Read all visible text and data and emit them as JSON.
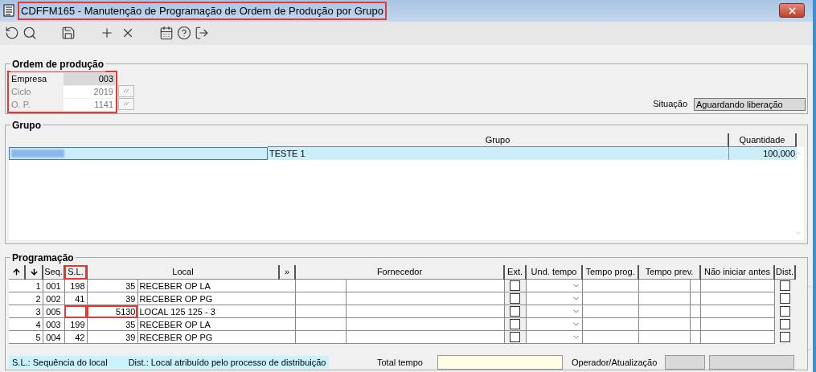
{
  "window": {
    "title": "CDFFM165 - Manutenção de Programação de Ordem de Produção por Grupo",
    "title_highlighted": true
  },
  "ordem": {
    "legend": "Ordem de produção",
    "highlighted": true,
    "fields": [
      {
        "label": "Empresa",
        "value": "003",
        "disabled": false,
        "lookup": false
      },
      {
        "label": "Ciclo",
        "value": "2019",
        "disabled": true,
        "lookup": true
      },
      {
        "label": "O. P.",
        "value": "1141",
        "disabled": true,
        "lookup": true
      }
    ],
    "situacao": {
      "label": "Situação",
      "value": "Aguardando liberação"
    }
  },
  "grupo": {
    "legend": "Grupo",
    "columns": [
      "Grupo",
      "Quantidade"
    ],
    "rows": [
      {
        "selected": true,
        "grupo": "TESTE 1",
        "quantidade": "100,000"
      }
    ]
  },
  "programacao": {
    "legend": "Programação",
    "columns": [
      {
        "label": "Seq.",
        "highlighted": false
      },
      {
        "label": "S.L.",
        "highlighted": true
      },
      {
        "label": "Local",
        "highlighted": false
      },
      {
        "label": "»",
        "highlighted": false
      },
      {
        "label": "Fornecedor",
        "highlighted": false
      },
      {
        "label": "Ext.",
        "highlighted": false
      },
      {
        "label": "Und. tempo",
        "highlighted": false
      },
      {
        "label": "Tempo prog.",
        "highlighted": false
      },
      {
        "label": "Tempo prev.",
        "highlighted": false
      },
      {
        "label": "Não iniciar antes",
        "highlighted": false
      },
      {
        "label": "Dist.",
        "highlighted": false
      }
    ],
    "rows": [
      {
        "num": "1",
        "seq": "001",
        "sl": "198",
        "local_code": "35",
        "local": "RECEBER OP LA",
        "ext": false,
        "dist": false,
        "highlighted": false
      },
      {
        "num": "2",
        "seq": "002",
        "sl": "41",
        "local_code": "39",
        "local": "RECEBER OP PG",
        "ext": false,
        "dist": false,
        "highlighted": false
      },
      {
        "num": "3",
        "seq": "005",
        "sl": "",
        "local_code": "5130",
        "local": "LOCAL 125 125 - 3",
        "ext": false,
        "dist": false,
        "highlighted": true
      },
      {
        "num": "4",
        "seq": "003",
        "sl": "199",
        "local_code": "35",
        "local": "RECEBER OP LA",
        "ext": false,
        "dist": false,
        "highlighted": false
      },
      {
        "num": "5",
        "seq": "004",
        "sl": "42",
        "local_code": "39",
        "local": "RECEBER OP PG",
        "ext": false,
        "dist": false,
        "highlighted": false
      }
    ]
  },
  "footer": {
    "legend": "S.L.: Sequência do local",
    "legend2": "Dist.: Local atribuído pelo processo de distribuição",
    "total_label": "Total tempo",
    "operador_label": "Operador/Atualização"
  }
}
